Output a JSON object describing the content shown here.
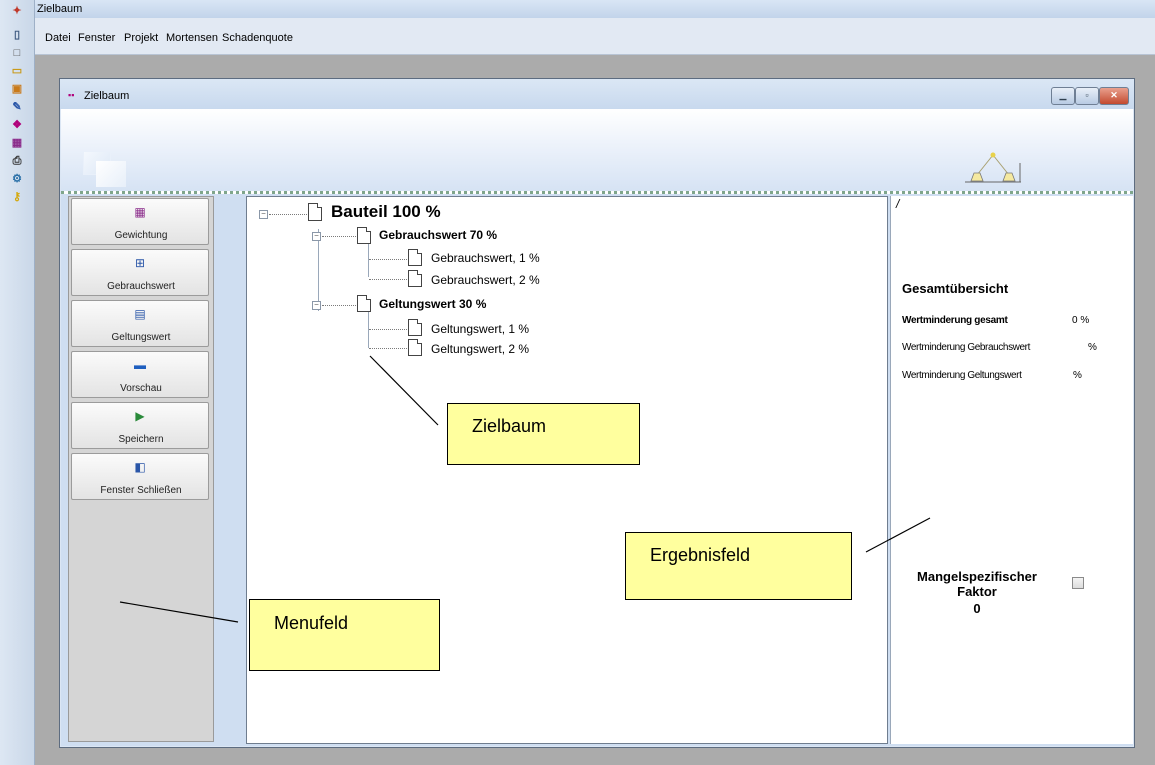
{
  "app": {
    "title": "Zielbaum",
    "menu": [
      "Datei",
      "Fenster",
      "Projekt",
      "Mortensen",
      "Schadenquote"
    ]
  },
  "toolbar": {
    "icons": [
      "app-icon",
      "window-icon",
      "new-icon",
      "open-icon",
      "folder-tools-icon",
      "pin-icon",
      "tree-icon",
      "grid-icon",
      "printer-icon",
      "network-icon",
      "key-icon"
    ]
  },
  "window": {
    "title": "Zielbaum",
    "controls": [
      "minimize",
      "maximize",
      "close"
    ]
  },
  "menu_panel": {
    "buttons": [
      {
        "label": "Gewichtung",
        "icon": "weighting-icon"
      },
      {
        "label": "Gebrauchswert",
        "icon": "calculator-icon"
      },
      {
        "label": "Geltungswert",
        "icon": "document-icon"
      },
      {
        "label": "Vorschau",
        "icon": "monitor-icon"
      },
      {
        "label": "Speichern",
        "icon": "save-icon"
      },
      {
        "label": "Fenster Schließen",
        "icon": "close-window-icon"
      }
    ]
  },
  "tree": {
    "root": "Bauteil 100 %",
    "groups": [
      {
        "label": "Gebrauchswert  70 %",
        "children": [
          "Gebrauchswert, 1  %",
          "Gebrauchswert, 2  %"
        ]
      },
      {
        "label": "Geltungswert  30 %",
        "children": [
          "Geltungswert, 1  %",
          "Geltungswert, 2  %"
        ]
      }
    ]
  },
  "results": {
    "marker": "/",
    "heading": "Gesamtübersicht",
    "rows": [
      {
        "label": "Wertminderung gesamt",
        "value": "0 %"
      },
      {
        "label": "Wertminderung Gebrauchswert",
        "value": "%"
      },
      {
        "label": "Wertminderung Geltungswert",
        "value": "%"
      }
    ],
    "factor_label_line1": "Mangelspezifischer",
    "factor_label_line2": "Faktor",
    "factor_value": "0"
  },
  "annotations": {
    "zielbaum": "Zielbaum",
    "ergebnisfeld": "Ergebnisfeld",
    "menufeld": "Menufeld"
  }
}
